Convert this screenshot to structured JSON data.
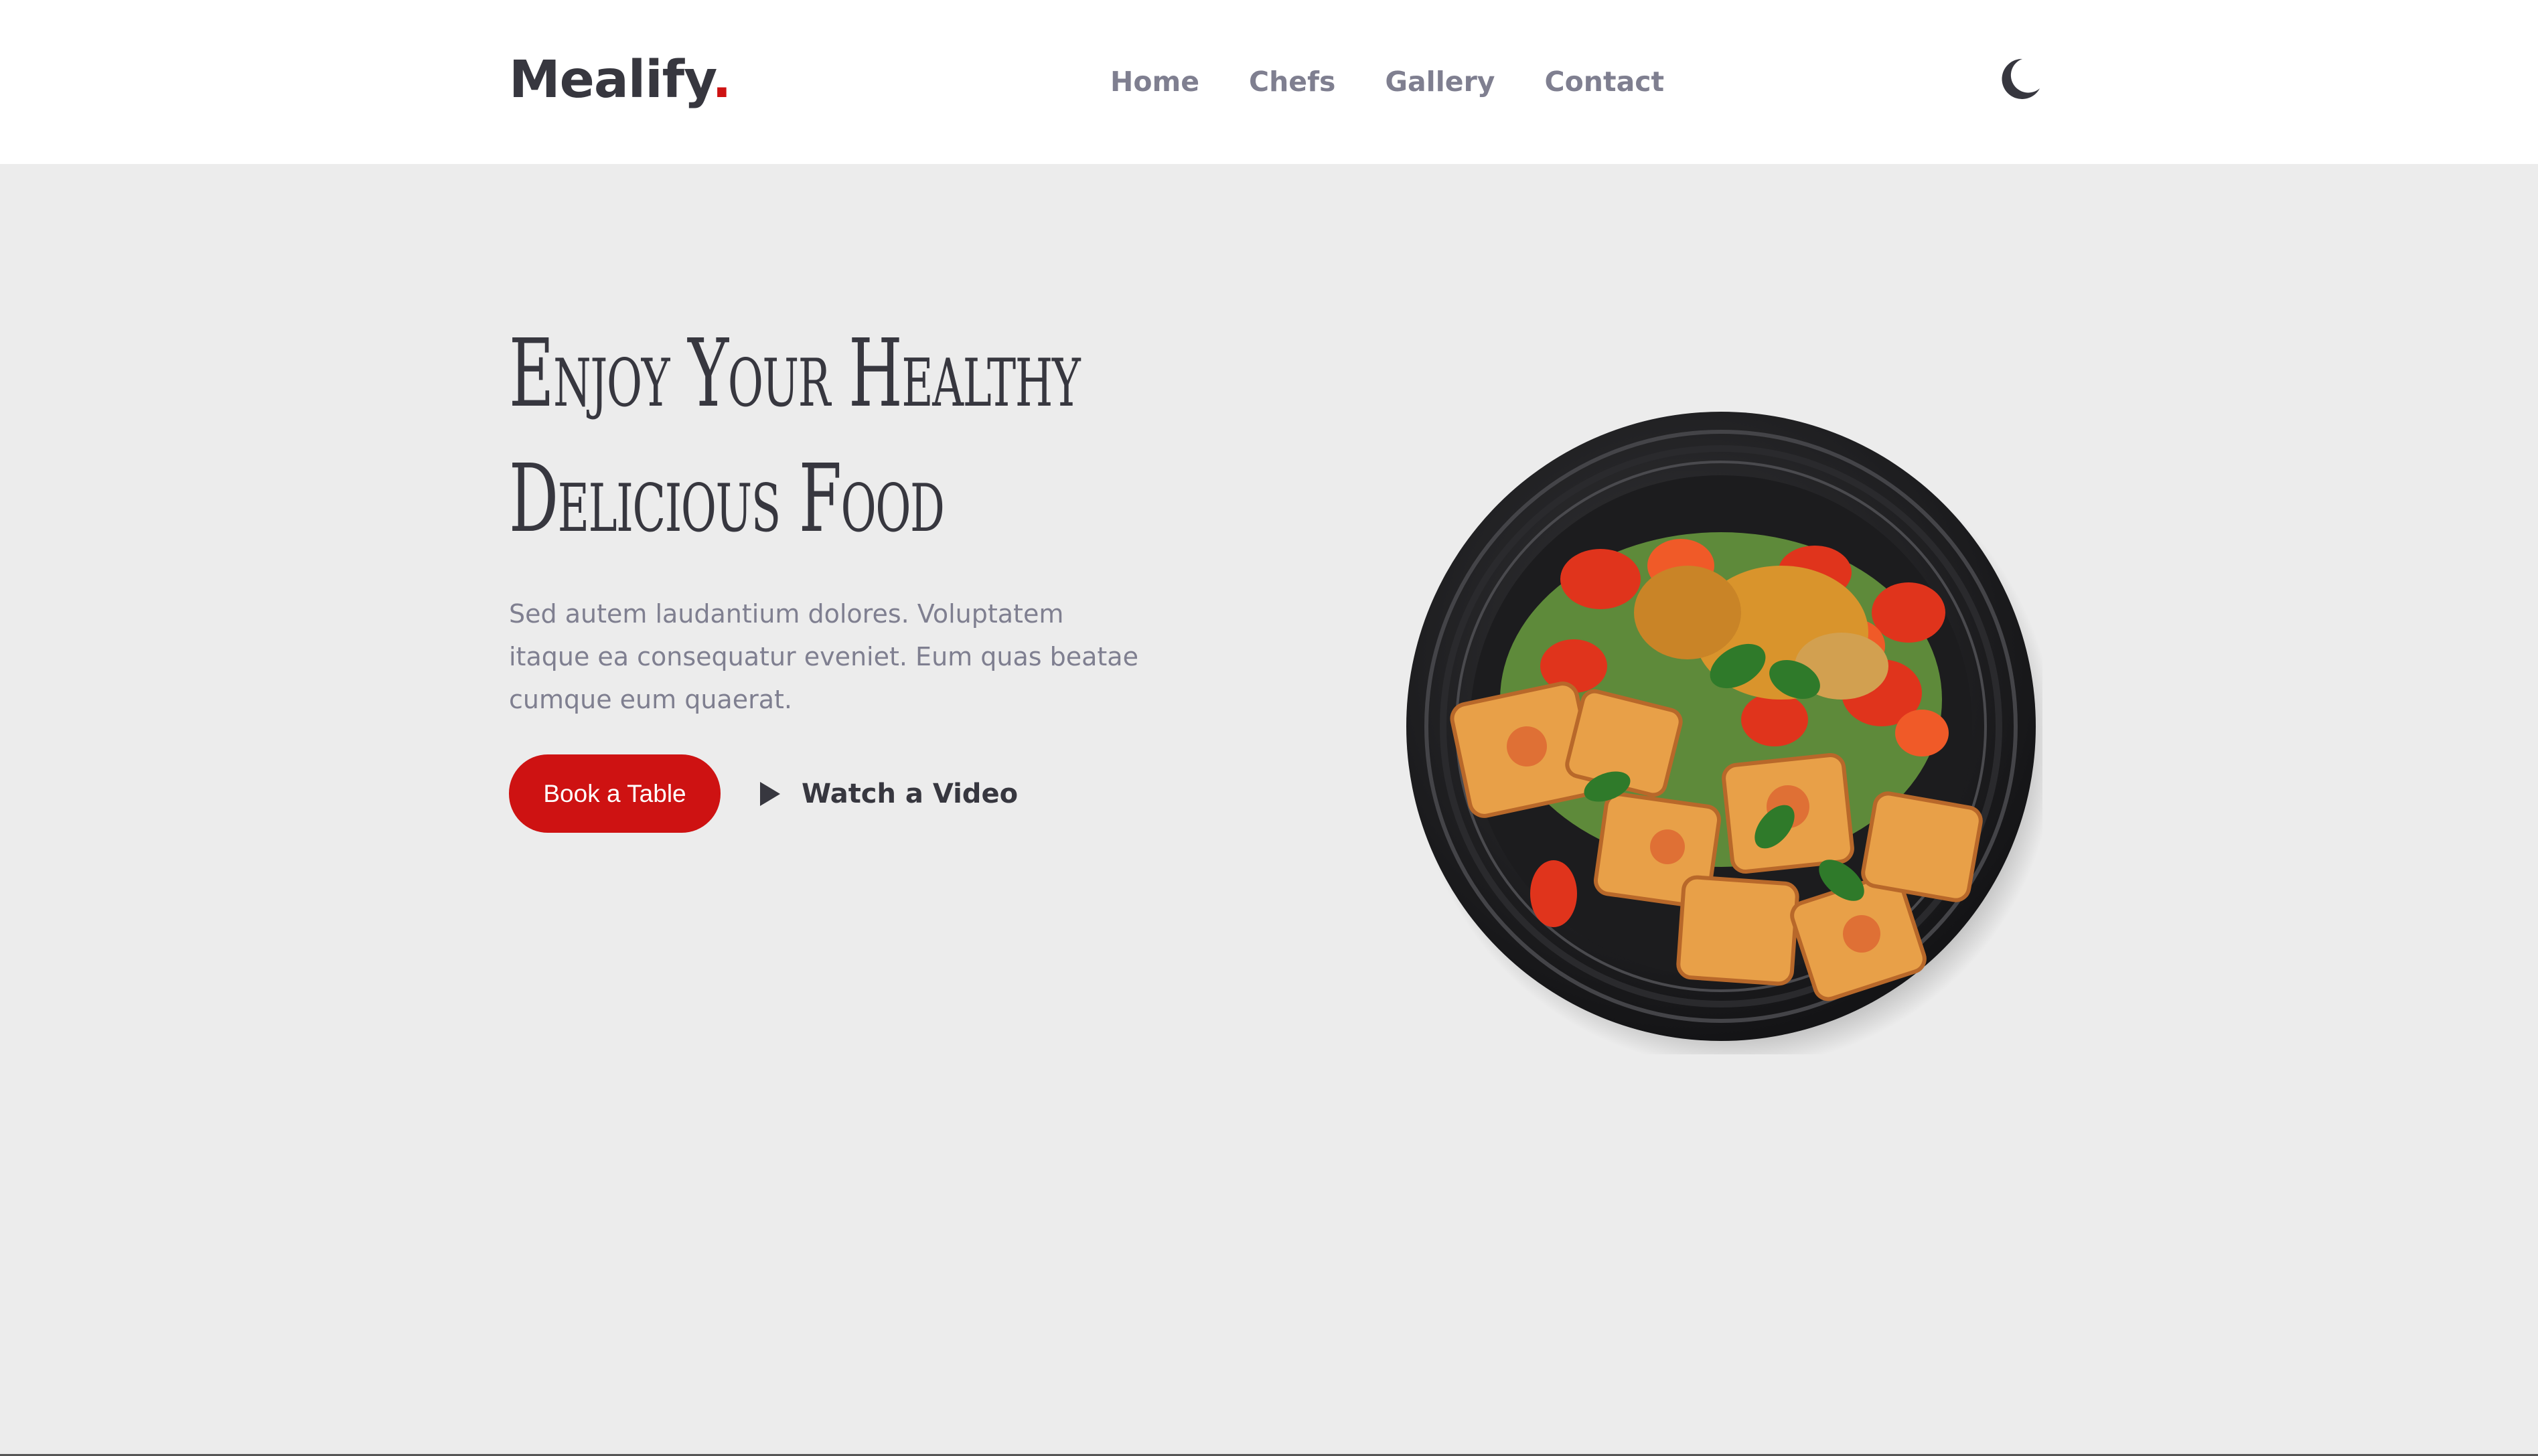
{
  "header": {
    "logo_text": "Mealify",
    "logo_dot": ".",
    "nav": [
      {
        "label": "Home"
      },
      {
        "label": "Chefs"
      },
      {
        "label": "Gallery"
      },
      {
        "label": "Contact"
      }
    ],
    "theme_toggle_icon": "moon-icon"
  },
  "hero": {
    "title_line1": "Enjoy Your Healthy",
    "title_line2": "Delicious Food",
    "description": "Sed autem laudantium dolores. Voluptatem itaque ea consequatur eveniet. Eum quas beatae cumque eum quaerat.",
    "book_button": "Book a Table",
    "video_button": "Watch a Video",
    "video_icon": "play-icon",
    "image": "food-bowl-image"
  },
  "colors": {
    "accent": "#ce1212",
    "text_dark": "#37373f",
    "text_muted": "#7f7f90",
    "background": "#ececec",
    "header_bg": "#ffffff"
  }
}
